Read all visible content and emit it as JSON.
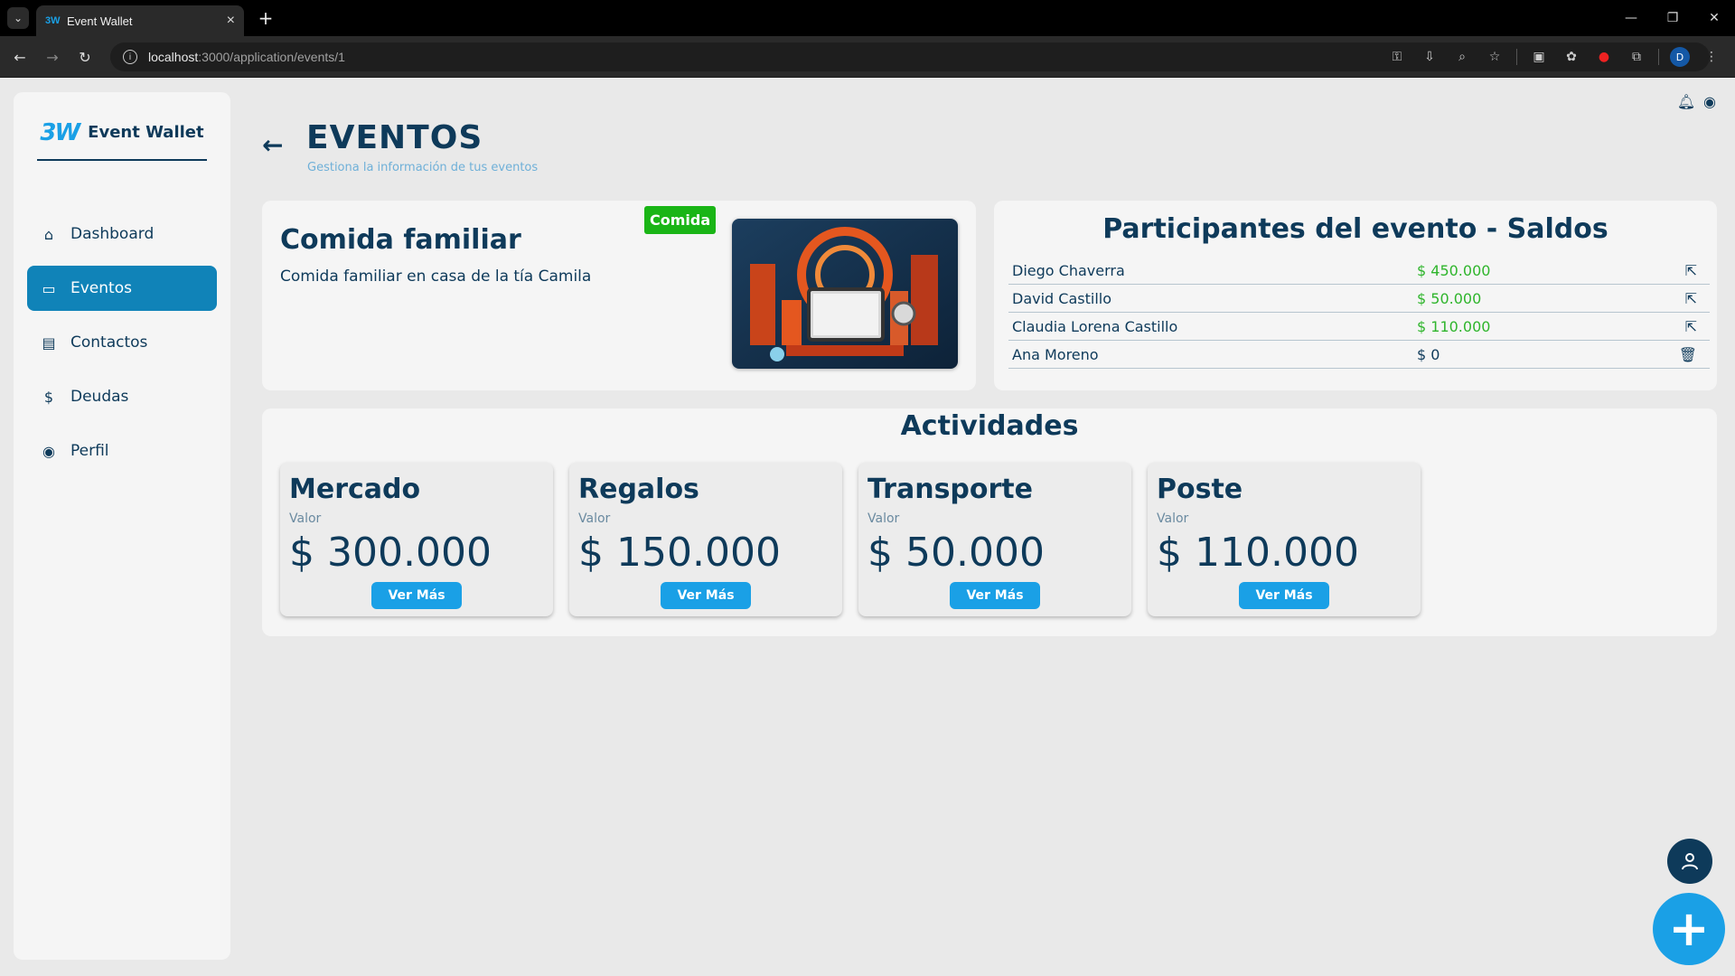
{
  "browser": {
    "tab_title": "Event Wallet",
    "tab_favicon": "3W",
    "url_host": "localhost",
    "url_path": ":3000/application/events/1",
    "profile_initial": "D"
  },
  "sidebar": {
    "brand_logo": "3W",
    "brand_name": "Event Wallet",
    "items": [
      {
        "label": "Dashboard",
        "icon": "home-icon",
        "active": false
      },
      {
        "label": "Eventos",
        "icon": "calendar-icon",
        "active": true
      },
      {
        "label": "Contactos",
        "icon": "contacts-icon",
        "active": false
      },
      {
        "label": "Deudas",
        "icon": "money-icon",
        "active": false
      },
      {
        "label": "Perfil",
        "icon": "user-circle-icon",
        "active": false
      }
    ]
  },
  "header": {
    "title": "EVENTOS",
    "subtitle": "Gestiona la información de tus eventos"
  },
  "event": {
    "name": "Comida familiar",
    "description": "Comida familiar en casa de la tía Camila",
    "badge": "Comida"
  },
  "participants": {
    "title": "Participantes del evento - Saldos",
    "rows": [
      {
        "name": "Diego Chaverra",
        "amount": "$ 450.000",
        "action": "open-icon"
      },
      {
        "name": "David Castillo",
        "amount": "$ 50.000",
        "action": "open-icon"
      },
      {
        "name": "Claudia Lorena Castillo",
        "amount": "$ 110.000",
        "action": "open-icon"
      },
      {
        "name": "Ana Moreno",
        "amount": "$ 0",
        "action": "trash-icon"
      }
    ]
  },
  "activities": {
    "title": "Actividades",
    "value_label": "Valor",
    "button_label": "Ver Más",
    "items": [
      {
        "name": "Mercado",
        "value": "$ 300.000"
      },
      {
        "name": "Regalos",
        "value": "$ 150.000"
      },
      {
        "name": "Transporte",
        "value": "$ 50.000"
      },
      {
        "name": "Poste",
        "value": "$ 110.000"
      }
    ]
  },
  "colors": {
    "primary": "#0e3a5a",
    "accent": "#1aa0e6",
    "active_nav": "#1083b8",
    "badge": "#1ab516",
    "positive": "#2fb52c"
  }
}
